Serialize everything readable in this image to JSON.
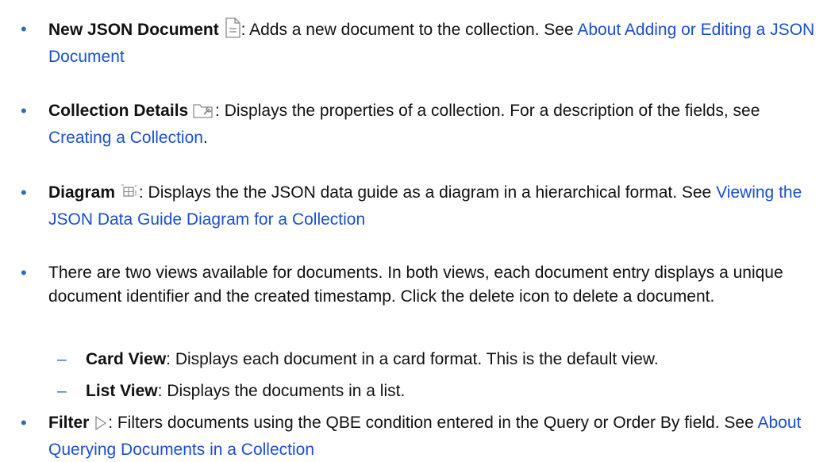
{
  "items": [
    {
      "term": "New JSON Document",
      "icon": "new-document-icon",
      "text": ": Adds a new document to the collection. See ",
      "link": "About Adding or Editing a JSON Document",
      "after": ""
    },
    {
      "term": "Collection Details",
      "icon": "collection-details-icon",
      "text": ": Displays the properties of a collection. For a description of the fields, see ",
      "link": "Creating a Collection",
      "after": "."
    },
    {
      "term": "Diagram",
      "icon": "diagram-icon",
      "text": ": Displays the the JSON data guide as a diagram in a hierarchical format. See ",
      "link": "Viewing the JSON Data Guide Diagram for a Collection",
      "after": ""
    },
    {
      "text": "There are two views available for documents. In both views, each document entry displays a unique document identifier and the created timestamp. Click the delete icon to delete a document."
    },
    {
      "term": "Filter",
      "icon": "filter-icon",
      "text": ": Filters documents using the QBE condition entered in the Query or Order By field. See ",
      "link": "About Querying Documents in a Collection",
      "after": ""
    }
  ],
  "subitems": [
    {
      "term": "Card View",
      "text": ": Displays each document in a card format. This is the default view."
    },
    {
      "term": "List View",
      "text": ": Displays the documents in a list."
    }
  ],
  "colors": {
    "bullet": "#2f6cb2",
    "link": "#1a4fd0",
    "text": "#111111"
  }
}
